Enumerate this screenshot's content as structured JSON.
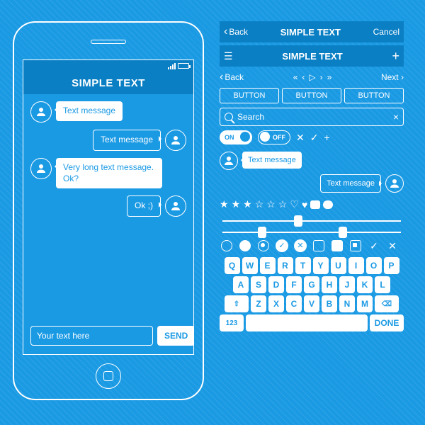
{
  "phone": {
    "title": "SIMPLE TEXT",
    "messages": [
      {
        "side": "left",
        "text": "Text message",
        "style": "filled"
      },
      {
        "side": "right",
        "text": "Text message",
        "style": "outline"
      },
      {
        "side": "left",
        "text": "Very long text message. Ok?",
        "style": "filled"
      },
      {
        "side": "right",
        "text": "Ok ;)",
        "style": "outline"
      }
    ],
    "input_placeholder": "Your text here",
    "send_label": "SEND"
  },
  "panel": {
    "nav1": {
      "back": "Back",
      "title": "SIMPLE TEXT",
      "cancel": "Cancel"
    },
    "nav2": {
      "title": "SIMPLE TEXT"
    },
    "pager": {
      "back": "Back",
      "next": "Next"
    },
    "buttons": [
      "BUTTON",
      "BUTTON",
      "BUTTON"
    ],
    "search_placeholder": "Search",
    "toggles": {
      "on": "ON",
      "off": "OFF"
    },
    "mini_msgs": [
      {
        "side": "left",
        "text": "Text message",
        "style": "filled"
      },
      {
        "side": "right",
        "text": "Text message",
        "style": "outline"
      }
    ],
    "rating": {
      "filled": 3,
      "total": 6
    },
    "keyboard": {
      "row1": [
        "Q",
        "W",
        "E",
        "R",
        "T",
        "Y",
        "U",
        "I",
        "O",
        "P"
      ],
      "row2": [
        "A",
        "S",
        "D",
        "F",
        "G",
        "H",
        "J",
        "K",
        "L"
      ],
      "row3_shift": "⇧",
      "row3": [
        "Z",
        "X",
        "C",
        "V",
        "B",
        "N",
        "M"
      ],
      "row3_del": "⌫",
      "num_key": "123",
      "done_key": "DONE"
    }
  }
}
